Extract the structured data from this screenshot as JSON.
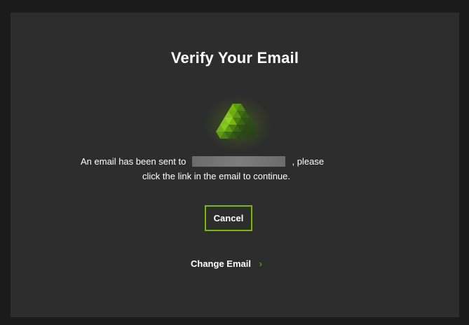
{
  "dialog": {
    "title": "Verify Your Email",
    "message_prefix": "An email has been sent to",
    "message_suffix": ", please",
    "message_line2": "click the link in the email to continue.",
    "cancel_label": "Cancel",
    "change_email_label": "Change Email",
    "change_email_icon": "chevron-right-icon",
    "logo_icon": "triangle-logo-icon"
  },
  "colors": {
    "accent": "#76b900",
    "panel_bg": "#2d2d2d",
    "page_bg": "#1b1b1b",
    "text": "#ffffff"
  }
}
